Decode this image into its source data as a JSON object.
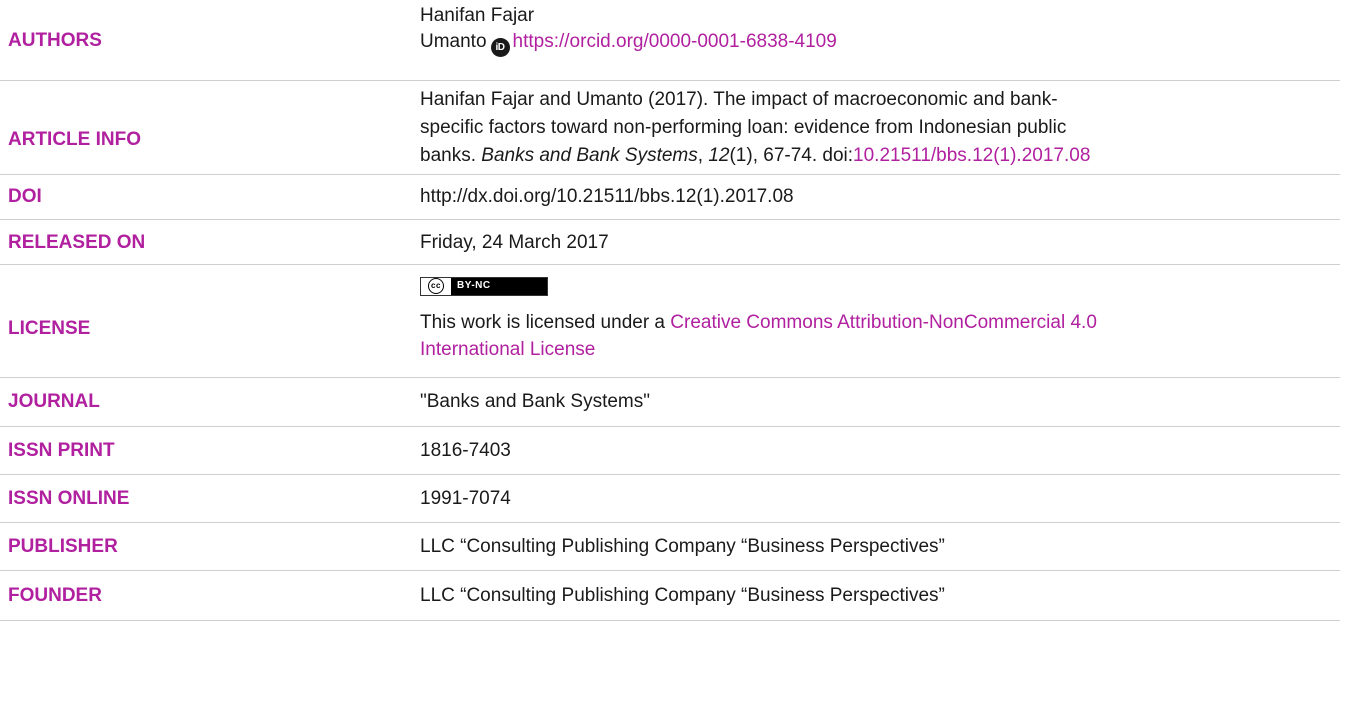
{
  "colors": {
    "label": "#b0209f",
    "link": "#b0209f",
    "text": "#1a1a1a",
    "divider": "#cfcfcf"
  },
  "rows": {
    "authors": {
      "label": "AUTHORS",
      "line1": "Hanifan Fajar",
      "name2": "Umanto",
      "orcid_icon": "orcid-icon",
      "orcid_url": "https://orcid.org/0000-0001-6838-4109"
    },
    "article_info": {
      "label": "ARTICLE INFO",
      "line1": "Hanifan Fajar and Umanto (2017). The impact of macroeconomic and bank-",
      "line2": "specific factors toward non-performing loan: evidence from Indonesian public",
      "line3_prefix": "banks. ",
      "journal_italic": "Banks and Bank Systems",
      "comma": ", ",
      "volume_italic": "12",
      "issue_pages": "(1), 67-74. doi:",
      "doi_link": "10.21511/bbs.12(1).2017.08"
    },
    "doi": {
      "label": "DOI",
      "value": "http://dx.doi.org/10.21511/bbs.12(1).2017.08"
    },
    "released_on": {
      "label": "RELEASED ON",
      "value": "Friday, 24 March 2017"
    },
    "license": {
      "label": "LICENSE",
      "badge_cc": "cc",
      "badge_text": "BY-NC",
      "text_prefix": "This work is licensed under a ",
      "link_line1": "Creative Commons Attribution-NonCommercial 4.0",
      "link_line2": "International License"
    },
    "journal": {
      "label": "JOURNAL",
      "value": "\"Banks and Bank Systems\""
    },
    "issn_print": {
      "label": "ISSN PRINT",
      "value": "1816-7403"
    },
    "issn_online": {
      "label": "ISSN ONLINE",
      "value": "1991-7074"
    },
    "publisher": {
      "label": "PUBLISHER",
      "value": "LLC “Consulting Publishing Company “Business Perspectives”"
    },
    "founder": {
      "label": "FOUNDER",
      "value": "LLC “Consulting Publishing Company “Business Perspectives”"
    }
  }
}
